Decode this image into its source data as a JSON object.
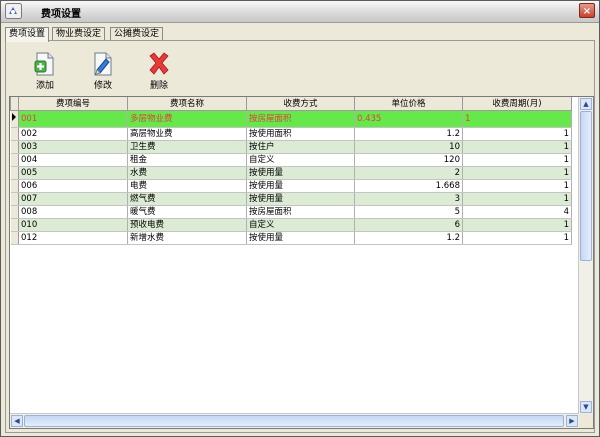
{
  "window": {
    "title": "费项设置",
    "close_label": "×"
  },
  "tabs": [
    {
      "label": "费项设置",
      "active": true
    },
    {
      "label": "物业费设定",
      "active": false
    },
    {
      "label": "公摊费设定",
      "active": false
    }
  ],
  "toolbar": {
    "add_label": "添加",
    "edit_label": "修改",
    "delete_label": "删除"
  },
  "table": {
    "columns": [
      "费项编号",
      "费项名称",
      "收费方式",
      "单位价格",
      "收费周期(月)"
    ],
    "rows": [
      {
        "code": "001",
        "name": "多层物业费",
        "method": "按房屋面积",
        "price": "0.435",
        "period": "1",
        "selected": true
      },
      {
        "code": "002",
        "name": "高层物业费",
        "method": "按使用面积",
        "price": "1.2",
        "period": "1"
      },
      {
        "code": "003",
        "name": "卫生费",
        "method": "按住户",
        "price": "10",
        "period": "1"
      },
      {
        "code": "004",
        "name": "租金",
        "method": "自定义",
        "price": "120",
        "period": "1"
      },
      {
        "code": "005",
        "name": "水费",
        "method": "按使用量",
        "price": "2",
        "period": "1"
      },
      {
        "code": "006",
        "name": "电费",
        "method": "按使用量",
        "price": "1.668",
        "period": "1"
      },
      {
        "code": "007",
        "name": "燃气费",
        "method": "按使用量",
        "price": "3",
        "period": "1"
      },
      {
        "code": "008",
        "name": "暖气费",
        "method": "按房屋面积",
        "price": "5",
        "period": "4"
      },
      {
        "code": "010",
        "name": "预收电费",
        "method": "自定义",
        "price": "6",
        "period": "1"
      },
      {
        "code": "012",
        "name": "新增水费",
        "method": "按使用量",
        "price": "1.2",
        "period": "1"
      }
    ]
  },
  "colors": {
    "selected_row": "#66e84a",
    "selected_text": "#e04040",
    "alt_row": "#dcebd4"
  },
  "icons": {
    "app": "app-icon",
    "add": "add-document-icon",
    "edit": "edit-document-icon",
    "delete": "delete-x-icon"
  }
}
